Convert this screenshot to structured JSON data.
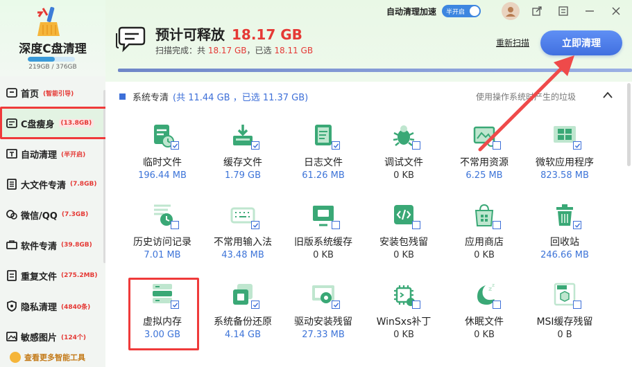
{
  "app": {
    "name": "深度C盘清理",
    "disk_usage": "219GB / 376GB",
    "disk_used_fraction": 0.58
  },
  "sidebar": {
    "items": [
      {
        "label": "首页",
        "badge": "(智能引导)",
        "icon": "home-icon"
      },
      {
        "label": "C盘瘦身",
        "badge": "(13.8GB)",
        "icon": "disk-icon",
        "active": true
      },
      {
        "label": "自动清理",
        "badge": "(半开启)",
        "icon": "auto-clean-icon"
      },
      {
        "label": "大文件专清",
        "badge": "(7.8GB)",
        "icon": "big-file-icon"
      },
      {
        "label": "微信/QQ",
        "badge": "(7.3GB)",
        "icon": "chat-app-icon"
      },
      {
        "label": "软件专清",
        "badge": "(39.8GB)",
        "icon": "software-icon"
      },
      {
        "label": "重复文件",
        "badge": "(275.2MB)",
        "icon": "duplicate-file-icon"
      },
      {
        "label": "隐私清理",
        "badge": "(4840条)",
        "icon": "privacy-icon"
      },
      {
        "label": "敏感图片",
        "badge": "(124个)",
        "icon": "image-icon"
      }
    ],
    "more_tools": "查看更多智能工具"
  },
  "topbar": {
    "auto_clean_label": "自动清理加速",
    "toggle_label": "半开启"
  },
  "header": {
    "headline_label": "预计可释放",
    "headline_value": "18.17 GB",
    "scan_prefix": "扫描完成：共 ",
    "scan_total": "18.17 GB",
    "scan_mid": "，已选 ",
    "scan_selected": "18.11 GB",
    "rescan": "重新扫描",
    "clean_now": "立即清理"
  },
  "section": {
    "title": "系统专清",
    "stats": "(共 11.44 GB ，已选 11.37 GB)",
    "description": "使用操作系统时产生的垃圾"
  },
  "items": [
    {
      "name": "临时文件",
      "size": "196.44 MB",
      "checked": true,
      "icon": "temp-file-icon",
      "color": "#3aa876"
    },
    {
      "name": "缓存文件",
      "size": "1.79 GB",
      "checked": true,
      "icon": "cache-download-icon",
      "color": "#3aa876"
    },
    {
      "name": "日志文件",
      "size": "61.26 MB",
      "checked": true,
      "icon": "log-notebook-icon",
      "color": "#3aa876"
    },
    {
      "name": "调试文件",
      "size": "0 KB",
      "checked": false,
      "icon": "bug-icon",
      "color": "#3aa876"
    },
    {
      "name": "不常用资源",
      "size": "6.25 MB",
      "checked": false,
      "icon": "unused-resource-icon",
      "color": "#3aa876"
    },
    {
      "name": "微软应用程序",
      "size": "823.58 MB",
      "checked": true,
      "icon": "windows-app-icon",
      "color": "#3aa876"
    },
    {
      "name": "历史访问记录",
      "size": "7.01 MB",
      "checked": false,
      "icon": "history-icon",
      "color": "#3aa876"
    },
    {
      "name": "不常用输入法",
      "size": "43.48 MB",
      "checked": true,
      "icon": "keyboard-icon",
      "color": "#3aa876"
    },
    {
      "name": "旧版系统缓存",
      "size": "0 KB",
      "checked": false,
      "icon": "monitor-icon",
      "color": "#3aa876"
    },
    {
      "name": "安装包残留",
      "size": "0 KB",
      "checked": false,
      "icon": "code-package-icon",
      "color": "#3aa876"
    },
    {
      "name": "应用商店",
      "size": "0 KB",
      "checked": false,
      "icon": "store-bag-icon",
      "color": "#3aa876"
    },
    {
      "name": "回收站",
      "size": "246.66 MB",
      "checked": true,
      "icon": "recycle-bin-icon",
      "color": "#3aa876"
    },
    {
      "name": "虚拟内存",
      "size": "3.00 GB",
      "checked": true,
      "icon": "server-memory-icon",
      "color": "#3aa876"
    },
    {
      "name": "系统备份还原",
      "size": "4.14 GB",
      "checked": true,
      "icon": "backup-restore-icon",
      "color": "#3aa876"
    },
    {
      "name": "驱动安装残留",
      "size": "27.33 MB",
      "checked": true,
      "icon": "driver-monitor-icon",
      "color": "#3aa876"
    },
    {
      "name": "WinSxs补丁",
      "size": "0 KB",
      "checked": false,
      "icon": "patch-chip-icon",
      "color": "#3aa876"
    },
    {
      "name": "休眠文件",
      "size": "0 KB",
      "checked": false,
      "icon": "sleep-moon-icon",
      "color": "#3aa876"
    },
    {
      "name": "MSI缓存残留",
      "size": "0 B",
      "checked": false,
      "icon": "msi-box-icon",
      "color": "#3aa876"
    }
  ],
  "colors": {
    "accent_blue": "#3d6fd8",
    "highlight_red": "#ef3a3a",
    "value_red": "#e53935",
    "icon_green": "#3aa876"
  }
}
